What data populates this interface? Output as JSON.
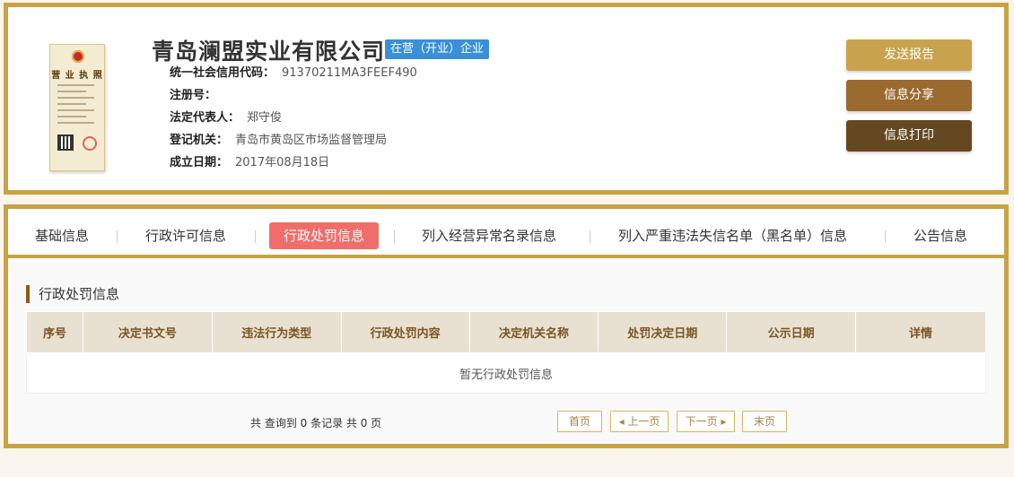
{
  "company": {
    "name": "青岛澜盟实业有限公司",
    "status": "在营（开业）企业",
    "license_image": {
      "title": "营 业 执 照"
    },
    "fields": [
      {
        "label": "统一社会信用代码：",
        "value": "91370211MA3FEEF490"
      },
      {
        "label": "注册号：",
        "value": ""
      },
      {
        "label": "法定代表人：",
        "value": "郑守俊"
      },
      {
        "label": "登记机关：",
        "value": "青岛市黄岛区市场监督管理局"
      },
      {
        "label": "成立日期：",
        "value": "2017年08月18日"
      }
    ]
  },
  "actions": {
    "send_report": "发送报告",
    "share_info": "信息分享",
    "print_info": "信息打印"
  },
  "tabs": [
    {
      "label": "基础信息",
      "active": false
    },
    {
      "label": "行政许可信息",
      "active": false
    },
    {
      "label": "行政处罚信息",
      "active": true
    },
    {
      "label": "列入经营异常名录信息",
      "active": false
    },
    {
      "label": "列入严重违法失信名单（黑名单）信息",
      "active": false
    },
    {
      "label": "公告信息",
      "active": false
    }
  ],
  "section": {
    "title": "行政处罚信息",
    "table": {
      "columns": [
        "序号",
        "决定书文号",
        "违法行为类型",
        "行政处罚内容",
        "决定机关名称",
        "处罚决定日期",
        "公示日期",
        "详情"
      ],
      "empty_text": "暂无行政处罚信息"
    }
  },
  "pager": {
    "summary": "共 查询到 0 条记录 共 0 页",
    "first": "首页",
    "prev": "上一页",
    "next": "下一页",
    "last": "末页"
  },
  "colors": {
    "border_gold": "#c9a243",
    "active_tab": "#f06e6a",
    "status_badge": "#3a90d8",
    "btn_send": "#c9a24d",
    "btn_share": "#9a6a2e",
    "btn_print": "#654822"
  }
}
